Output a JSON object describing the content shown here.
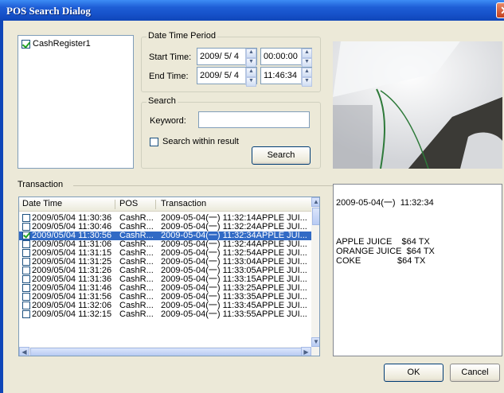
{
  "window": {
    "title": "POS Search Dialog",
    "close_glyph": "✕"
  },
  "devices": {
    "items": [
      {
        "label": "CashRegister1",
        "checked": true
      }
    ]
  },
  "date_time_period": {
    "group_label": "Date Time Period",
    "start_label": "Start Time:",
    "start_date": "2009/ 5/ 4",
    "start_time": "00:00:00",
    "end_label": "End Time:",
    "end_date": "2009/ 5/ 4",
    "end_time": "11:46:34"
  },
  "search": {
    "group_label": "Search",
    "keyword_label": "Keyword:",
    "keyword_value": "",
    "within_label": "Search within result",
    "within_checked": false,
    "button_label": "Search"
  },
  "transaction": {
    "section_label": "Transaction",
    "columns": [
      "Date Time",
      "POS",
      "Transaction"
    ],
    "rows": [
      {
        "dt": "2009/05/04 11:30:36",
        "pos": "CashR...",
        "tx": "2009-05-04(一)   11:32:14APPLE JUI...",
        "checked": false,
        "selected": false
      },
      {
        "dt": "2009/05/04 11:30:46",
        "pos": "CashR...",
        "tx": "2009-05-04(一)   11:32:24APPLE JUI...",
        "checked": false,
        "selected": false
      },
      {
        "dt": "2009/05/04 11:30:56",
        "pos": "CashR...",
        "tx": "2009-05-04(一)   11:32:34APPLE JUI...",
        "checked": true,
        "selected": true
      },
      {
        "dt": "2009/05/04 11:31:06",
        "pos": "CashR...",
        "tx": "2009-05-04(一)   11:32:44APPLE JUI...",
        "checked": false,
        "selected": false
      },
      {
        "dt": "2009/05/04 11:31:15",
        "pos": "CashR...",
        "tx": "2009-05-04(一)   11:32:54APPLE JUI...",
        "checked": false,
        "selected": false
      },
      {
        "dt": "2009/05/04 11:31:25",
        "pos": "CashR...",
        "tx": "2009-05-04(一)   11:33:04APPLE JUI...",
        "checked": false,
        "selected": false
      },
      {
        "dt": "2009/05/04 11:31:26",
        "pos": "CashR...",
        "tx": "2009-05-04(一)   11:33:05APPLE JUI...",
        "checked": false,
        "selected": false
      },
      {
        "dt": "2009/05/04 11:31:36",
        "pos": "CashR...",
        "tx": "2009-05-04(一)   11:33:15APPLE JUI...",
        "checked": false,
        "selected": false
      },
      {
        "dt": "2009/05/04 11:31:46",
        "pos": "CashR...",
        "tx": "2009-05-04(一)   11:33:25APPLE JUI...",
        "checked": false,
        "selected": false
      },
      {
        "dt": "2009/05/04 11:31:56",
        "pos": "CashR...",
        "tx": "2009-05-04(一)   11:33:35APPLE JUI...",
        "checked": false,
        "selected": false
      },
      {
        "dt": "2009/05/04 11:32:06",
        "pos": "CashR...",
        "tx": "2009-05-04(一)   11:33:45APPLE JUI...",
        "checked": false,
        "selected": false
      },
      {
        "dt": "2009/05/04 11:32:15",
        "pos": "CashR...",
        "tx": "2009-05-04(一)   11:33:55APPLE JUI...",
        "checked": false,
        "selected": false
      }
    ]
  },
  "detail": {
    "lines": [
      "2009-05-04(一)  11:32:34",
      "",
      "APPLE JUICE    $64 TX",
      "ORANGE JUICE  $64 TX",
      "COKE               $64 TX"
    ]
  },
  "footer": {
    "ok_label": "OK",
    "cancel_label": "Cancel"
  },
  "colors": {
    "selection": "#316ac5",
    "title_bar": "#1651c9",
    "dialog_bg": "#ece9d8"
  }
}
